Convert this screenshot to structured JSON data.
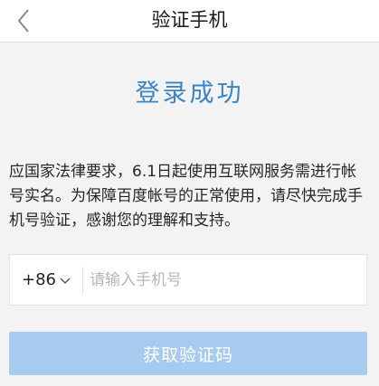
{
  "nav": {
    "title": "验证手机",
    "back_icon": "chevron-left-icon"
  },
  "status": {
    "heading": "登录成功"
  },
  "notice": {
    "text": "应国家法律要求，6.1日起使用互联网服务需进行帐号实名。为保障百度帐号的正常使用，请尽快完成手机号验证，感谢您的理解和支持。"
  },
  "phone": {
    "country_code": "+86",
    "country_code_icon": "chevron-down-icon",
    "value": "",
    "placeholder": "请输入手机号"
  },
  "actions": {
    "get_code_label": "获取验证码"
  },
  "colors": {
    "accent_text": "#3b84c4",
    "button_disabled": "#a6cbef",
    "background": "#f3f3f3"
  }
}
